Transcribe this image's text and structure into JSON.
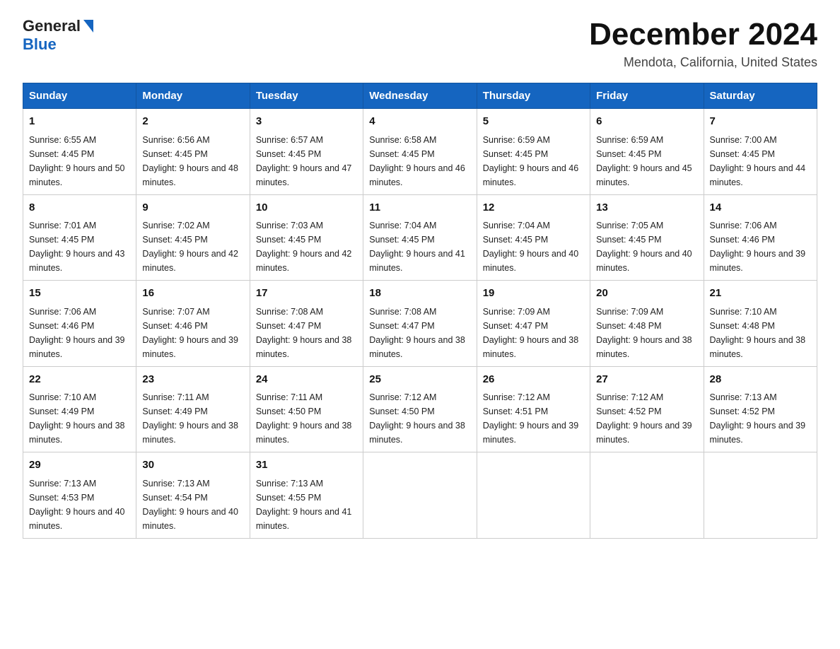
{
  "header": {
    "logo_general": "General",
    "logo_blue": "Blue",
    "title": "December 2024",
    "subtitle": "Mendota, California, United States"
  },
  "days_of_week": [
    "Sunday",
    "Monday",
    "Tuesday",
    "Wednesday",
    "Thursday",
    "Friday",
    "Saturday"
  ],
  "weeks": [
    [
      {
        "day": "1",
        "sunrise": "6:55 AM",
        "sunset": "4:45 PM",
        "daylight": "9 hours and 50 minutes."
      },
      {
        "day": "2",
        "sunrise": "6:56 AM",
        "sunset": "4:45 PM",
        "daylight": "9 hours and 48 minutes."
      },
      {
        "day": "3",
        "sunrise": "6:57 AM",
        "sunset": "4:45 PM",
        "daylight": "9 hours and 47 minutes."
      },
      {
        "day": "4",
        "sunrise": "6:58 AM",
        "sunset": "4:45 PM",
        "daylight": "9 hours and 46 minutes."
      },
      {
        "day": "5",
        "sunrise": "6:59 AM",
        "sunset": "4:45 PM",
        "daylight": "9 hours and 46 minutes."
      },
      {
        "day": "6",
        "sunrise": "6:59 AM",
        "sunset": "4:45 PM",
        "daylight": "9 hours and 45 minutes."
      },
      {
        "day": "7",
        "sunrise": "7:00 AM",
        "sunset": "4:45 PM",
        "daylight": "9 hours and 44 minutes."
      }
    ],
    [
      {
        "day": "8",
        "sunrise": "7:01 AM",
        "sunset": "4:45 PM",
        "daylight": "9 hours and 43 minutes."
      },
      {
        "day": "9",
        "sunrise": "7:02 AM",
        "sunset": "4:45 PM",
        "daylight": "9 hours and 42 minutes."
      },
      {
        "day": "10",
        "sunrise": "7:03 AM",
        "sunset": "4:45 PM",
        "daylight": "9 hours and 42 minutes."
      },
      {
        "day": "11",
        "sunrise": "7:04 AM",
        "sunset": "4:45 PM",
        "daylight": "9 hours and 41 minutes."
      },
      {
        "day": "12",
        "sunrise": "7:04 AM",
        "sunset": "4:45 PM",
        "daylight": "9 hours and 40 minutes."
      },
      {
        "day": "13",
        "sunrise": "7:05 AM",
        "sunset": "4:45 PM",
        "daylight": "9 hours and 40 minutes."
      },
      {
        "day": "14",
        "sunrise": "7:06 AM",
        "sunset": "4:46 PM",
        "daylight": "9 hours and 39 minutes."
      }
    ],
    [
      {
        "day": "15",
        "sunrise": "7:06 AM",
        "sunset": "4:46 PM",
        "daylight": "9 hours and 39 minutes."
      },
      {
        "day": "16",
        "sunrise": "7:07 AM",
        "sunset": "4:46 PM",
        "daylight": "9 hours and 39 minutes."
      },
      {
        "day": "17",
        "sunrise": "7:08 AM",
        "sunset": "4:47 PM",
        "daylight": "9 hours and 38 minutes."
      },
      {
        "day": "18",
        "sunrise": "7:08 AM",
        "sunset": "4:47 PM",
        "daylight": "9 hours and 38 minutes."
      },
      {
        "day": "19",
        "sunrise": "7:09 AM",
        "sunset": "4:47 PM",
        "daylight": "9 hours and 38 minutes."
      },
      {
        "day": "20",
        "sunrise": "7:09 AM",
        "sunset": "4:48 PM",
        "daylight": "9 hours and 38 minutes."
      },
      {
        "day": "21",
        "sunrise": "7:10 AM",
        "sunset": "4:48 PM",
        "daylight": "9 hours and 38 minutes."
      }
    ],
    [
      {
        "day": "22",
        "sunrise": "7:10 AM",
        "sunset": "4:49 PM",
        "daylight": "9 hours and 38 minutes."
      },
      {
        "day": "23",
        "sunrise": "7:11 AM",
        "sunset": "4:49 PM",
        "daylight": "9 hours and 38 minutes."
      },
      {
        "day": "24",
        "sunrise": "7:11 AM",
        "sunset": "4:50 PM",
        "daylight": "9 hours and 38 minutes."
      },
      {
        "day": "25",
        "sunrise": "7:12 AM",
        "sunset": "4:50 PM",
        "daylight": "9 hours and 38 minutes."
      },
      {
        "day": "26",
        "sunrise": "7:12 AM",
        "sunset": "4:51 PM",
        "daylight": "9 hours and 39 minutes."
      },
      {
        "day": "27",
        "sunrise": "7:12 AM",
        "sunset": "4:52 PM",
        "daylight": "9 hours and 39 minutes."
      },
      {
        "day": "28",
        "sunrise": "7:13 AM",
        "sunset": "4:52 PM",
        "daylight": "9 hours and 39 minutes."
      }
    ],
    [
      {
        "day": "29",
        "sunrise": "7:13 AM",
        "sunset": "4:53 PM",
        "daylight": "9 hours and 40 minutes."
      },
      {
        "day": "30",
        "sunrise": "7:13 AM",
        "sunset": "4:54 PM",
        "daylight": "9 hours and 40 minutes."
      },
      {
        "day": "31",
        "sunrise": "7:13 AM",
        "sunset": "4:55 PM",
        "daylight": "9 hours and 41 minutes."
      },
      null,
      null,
      null,
      null
    ]
  ]
}
